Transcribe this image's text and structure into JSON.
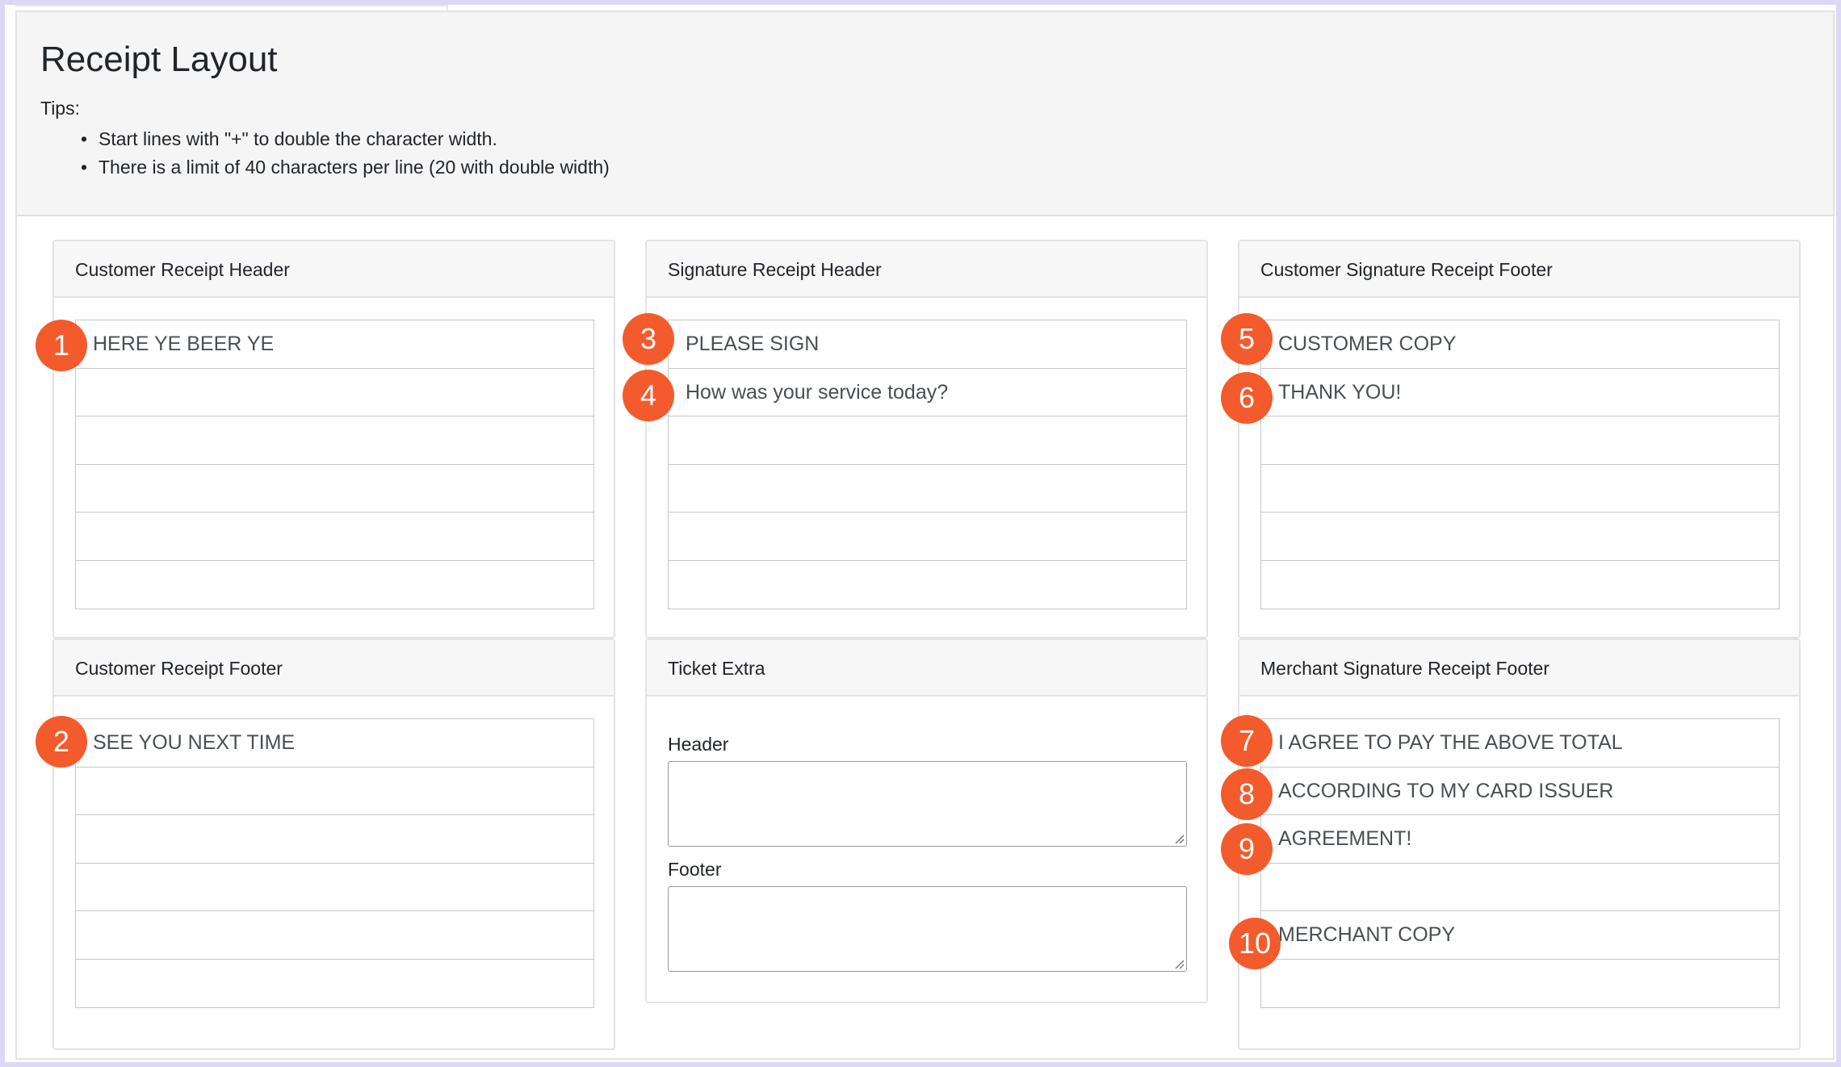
{
  "page": {
    "title": "Receipt Layout",
    "tips_label": "Tips:",
    "tips": [
      "Start lines with \"+\" to double the character width.",
      "There is a limit of 40 characters per line (20 with double width)"
    ]
  },
  "cards": {
    "customer_receipt_header": {
      "title": "Customer Receipt Header",
      "lines": [
        "HERE YE BEER YE",
        "",
        "",
        "",
        "",
        ""
      ]
    },
    "signature_receipt_header": {
      "title": "Signature Receipt Header",
      "lines": [
        "PLEASE SIGN",
        "How was your service today?",
        "",
        "",
        "",
        ""
      ]
    },
    "customer_signature_receipt_footer": {
      "title": "Customer Signature Receipt Footer",
      "lines": [
        "CUSTOMER COPY",
        "THANK YOU!",
        "",
        "",
        "",
        ""
      ]
    },
    "customer_receipt_footer": {
      "title": "Customer Receipt Footer",
      "lines": [
        "SEE YOU NEXT TIME",
        "",
        "",
        "",
        "",
        ""
      ]
    },
    "ticket_extra": {
      "title": "Ticket Extra",
      "header_label": "Header",
      "header_value": "",
      "footer_label": "Footer",
      "footer_value": ""
    },
    "merchant_signature_receipt_footer": {
      "title": "Merchant Signature Receipt Footer",
      "lines": [
        "I AGREE TO PAY THE ABOVE TOTAL",
        "ACCORDING TO MY CARD ISSUER",
        "AGREEMENT!",
        "",
        "MERCHANT COPY",
        ""
      ]
    }
  },
  "annotations": [
    "1",
    "2",
    "3",
    "4",
    "5",
    "6",
    "7",
    "8",
    "9",
    "10"
  ],
  "colors": {
    "badge": "#f35b2c",
    "panel_background": "#f5f5f5",
    "frame": "#ddd9f5"
  }
}
